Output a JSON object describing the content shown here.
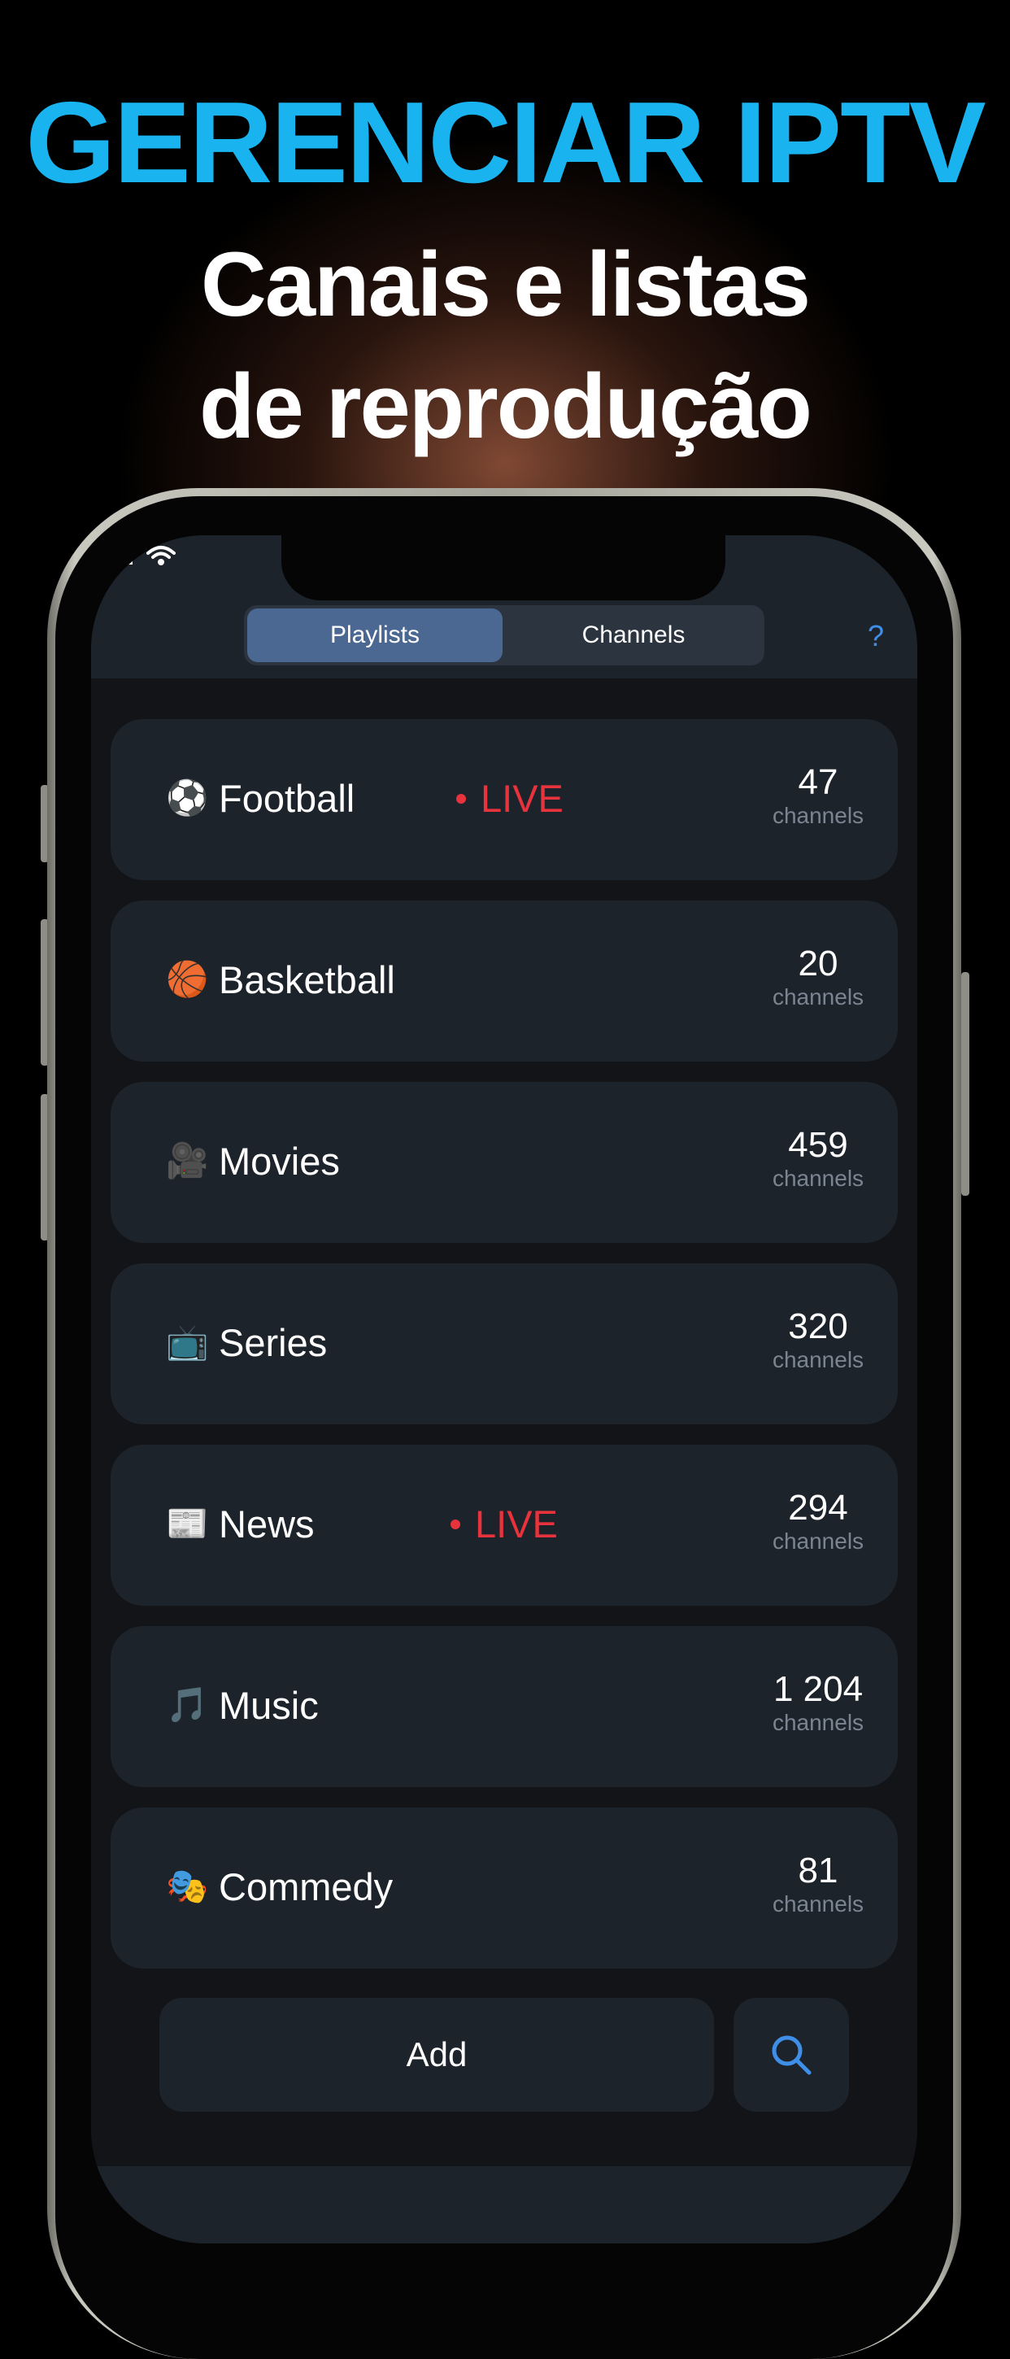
{
  "headline": {
    "line1": "GERENCIAR IPTV",
    "line2": "Canais e listas",
    "line3": "de reprodução"
  },
  "colors": {
    "headline_accent": "#19b4f0",
    "live_red": "#e8323c",
    "link_blue": "#3f8fe8",
    "segment_active": "#4a6891",
    "card_bg": "#1d232b"
  },
  "status_bar": {
    "icons": [
      "signal-icon",
      "wifi-icon"
    ]
  },
  "tabs": {
    "playlists": "Playlists",
    "channels": "Channels",
    "active": "Playlists"
  },
  "help": {
    "label": "?"
  },
  "playlists": [
    {
      "icon": "⚽",
      "icon_name": "soccer-ball-icon",
      "name": "Football",
      "live": "LIVE",
      "count": "47",
      "unit": "channels"
    },
    {
      "icon": "🏀",
      "icon_name": "basketball-icon",
      "name": "Basketball",
      "live": null,
      "count": "20",
      "unit": "channels"
    },
    {
      "icon": "🎥",
      "icon_name": "movie-camera-icon",
      "name": "Movies",
      "live": null,
      "count": "459",
      "unit": "channels"
    },
    {
      "icon": "📺",
      "icon_name": "television-icon",
      "name": "Series",
      "live": null,
      "count": "320",
      "unit": "channels"
    },
    {
      "icon": "📰",
      "icon_name": "newspaper-icon",
      "name": "News",
      "live": "LIVE",
      "count": "294",
      "unit": "channels"
    },
    {
      "icon": "🎵",
      "icon_name": "music-note-icon",
      "name": "Music",
      "live": null,
      "count": "1 204",
      "unit": "channels"
    },
    {
      "icon": "🎭",
      "icon_name": "theater-masks-icon",
      "name": "Commedy",
      "live": null,
      "count": "81",
      "unit": "channels"
    }
  ],
  "actions": {
    "add_label": "Add",
    "search_icon": "search-icon"
  }
}
